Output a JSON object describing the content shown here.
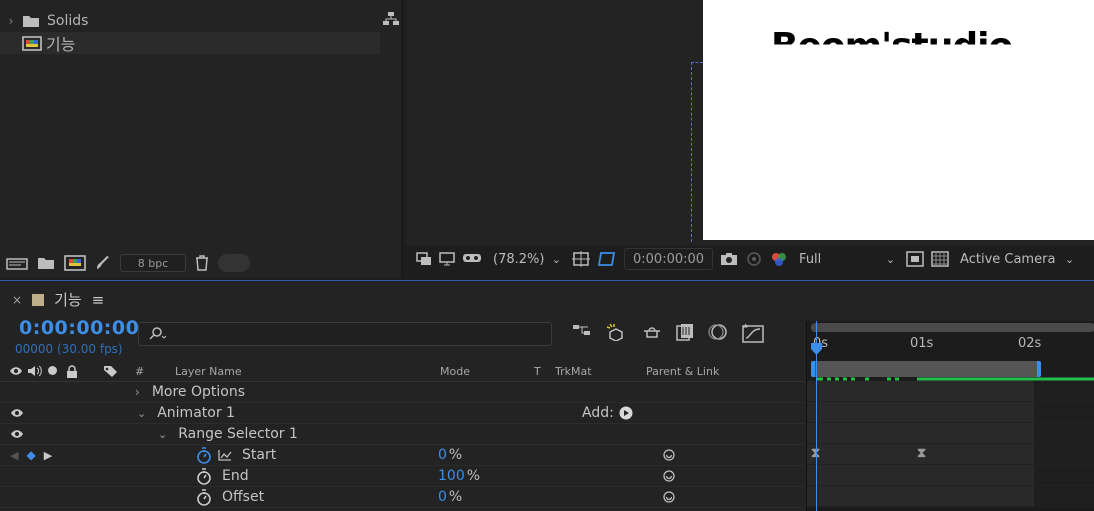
{
  "project": {
    "items": [
      {
        "name": "Solids",
        "type": "folder"
      },
      {
        "name": "기능",
        "type": "composition"
      }
    ],
    "bpc": "8 bpc"
  },
  "viewer": {
    "comp_text": "Beom'studio",
    "zoom": "(78.2%)",
    "timecode": "0:00:00:00",
    "resolution": "Full",
    "camera": "Active Camera"
  },
  "timeline": {
    "comp_name": "기능",
    "current_time": "0:00:00:00",
    "frames": "00000 (30.00 fps)",
    "columns": {
      "hash": "#",
      "layer_name": "Layer Name",
      "mode": "Mode",
      "t": "T",
      "trkmat": "TrkMat",
      "parent": "Parent & Link"
    },
    "rows": [
      {
        "label": "More Options"
      },
      {
        "label": "Animator 1",
        "add_label": "Add:"
      },
      {
        "label": "Range Selector 1"
      },
      {
        "label": "Start",
        "value": "0",
        "unit": "%"
      },
      {
        "label": "End",
        "value": "100",
        "unit": "%"
      },
      {
        "label": "Offset",
        "value": "0",
        "unit": "%"
      }
    ],
    "ruler": [
      "0s",
      "01s",
      "02s"
    ]
  },
  "colors": {
    "accent": "#3d8ee8",
    "keyframe_green": "#22c04a"
  }
}
